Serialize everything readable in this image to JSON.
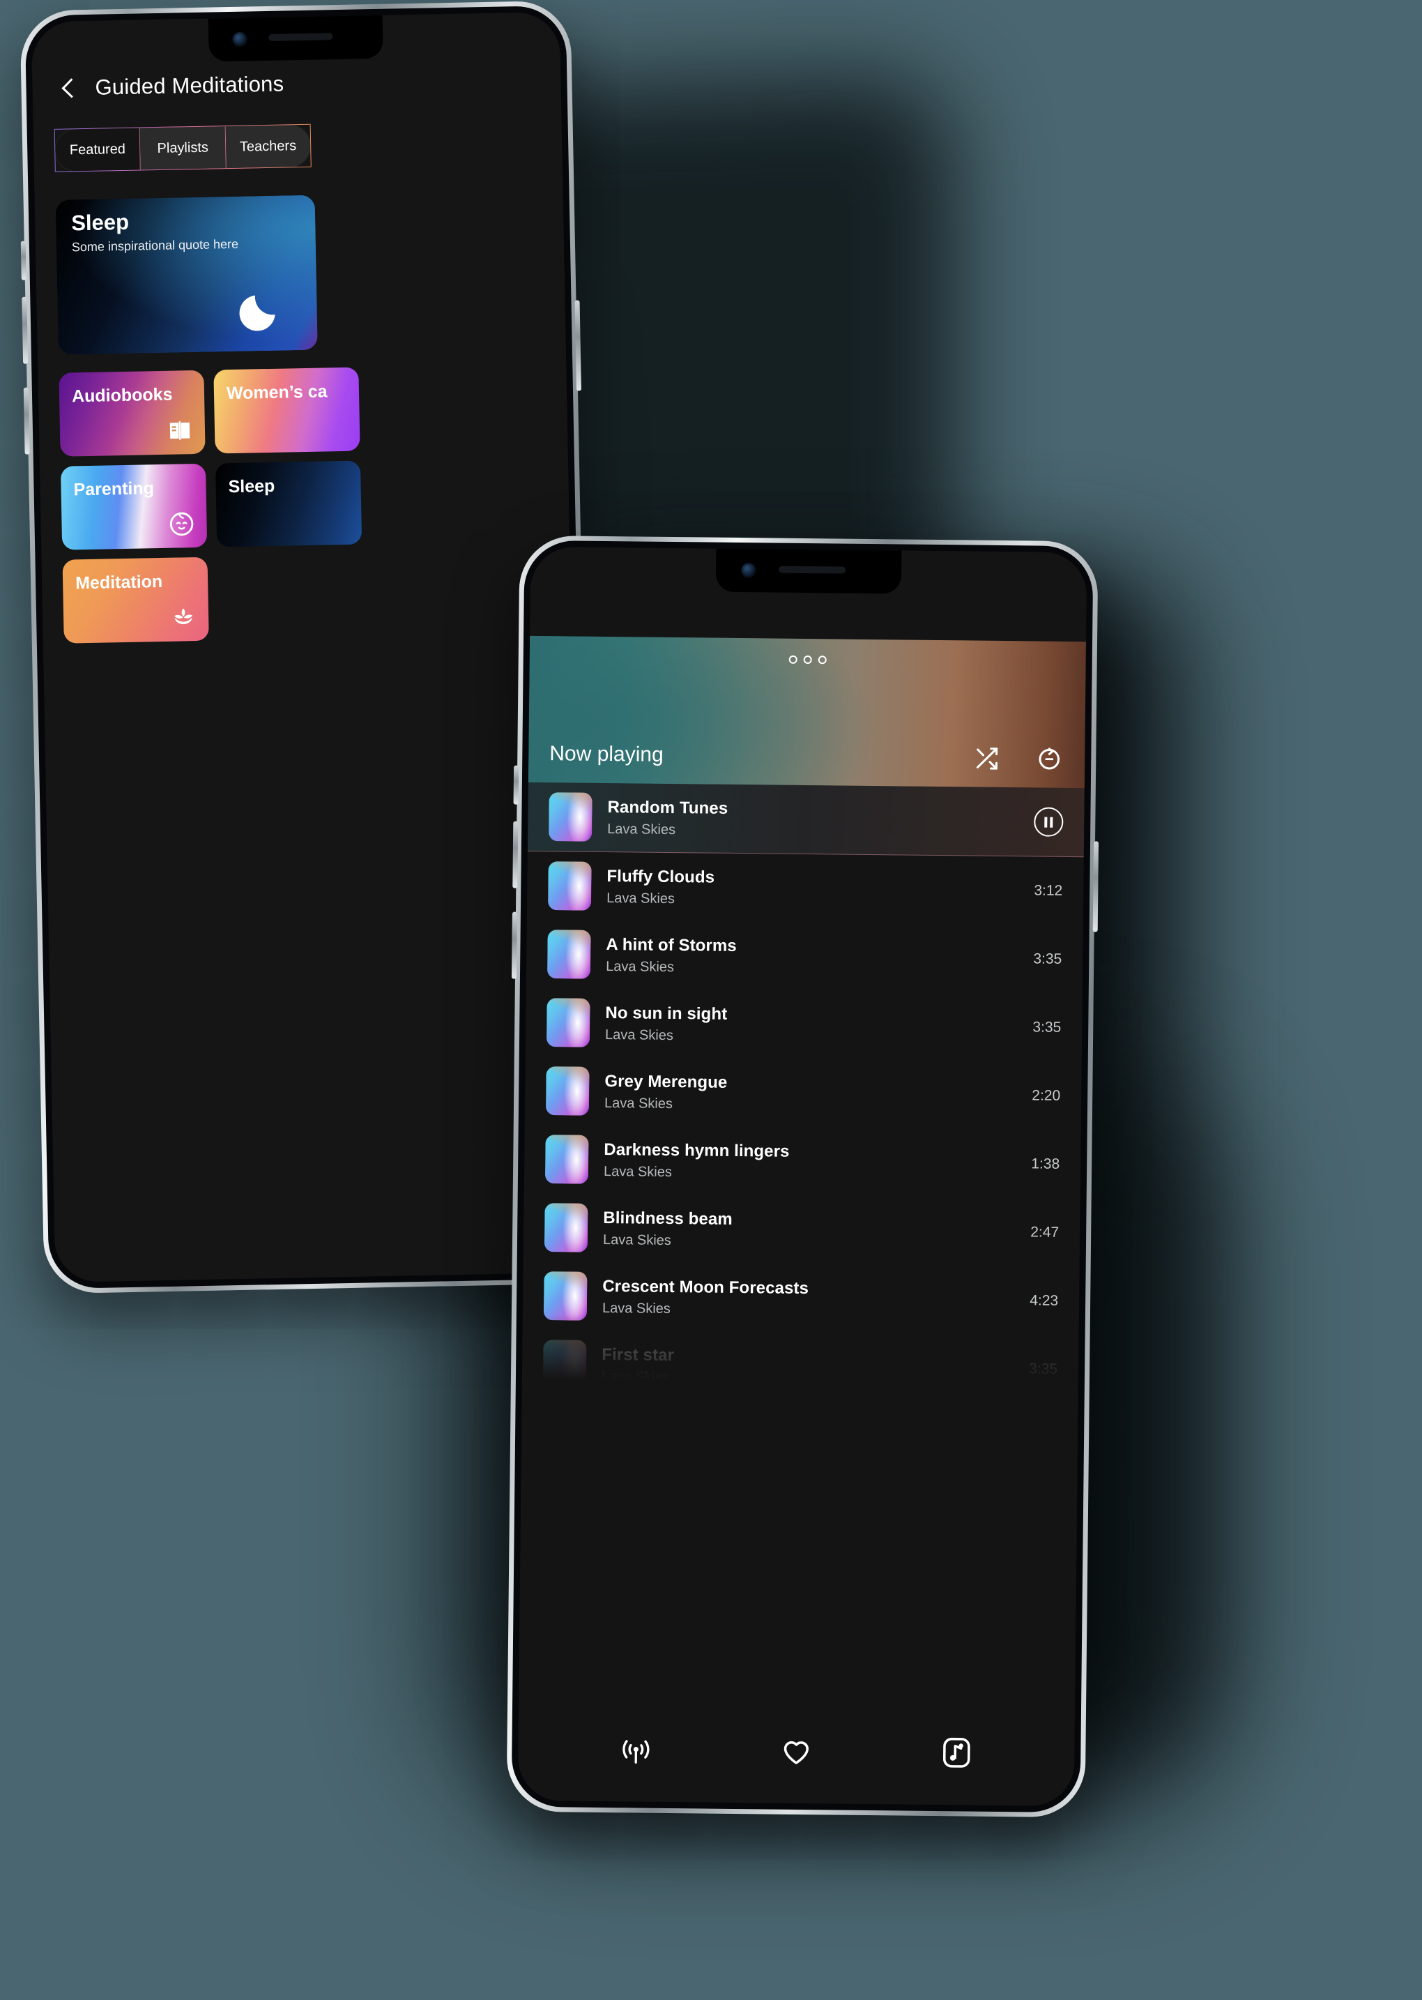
{
  "background_color": "#4a6670",
  "phone_a": {
    "header": {
      "back_icon": "chevron-left-icon",
      "title": "Guided Meditations"
    },
    "tabs": [
      {
        "label": "Featured",
        "active": true
      },
      {
        "label": "Playlists",
        "active": false
      },
      {
        "label": "Teachers",
        "active": false
      }
    ],
    "hero": {
      "title": "Sleep",
      "subtitle": "Some inspirational quote here",
      "icon": "crescent-moon-icon"
    },
    "tiles": [
      {
        "label": "Audiobooks",
        "icon": "open-book-icon",
        "style": "t-audiobooks"
      },
      {
        "label": "Women’s ca",
        "icon": "none",
        "style": "t-womens"
      },
      {
        "label": "Parenting",
        "icon": "baby-face-icon",
        "style": "t-parenting"
      },
      {
        "label": "Sleep",
        "icon": "none",
        "style": "t-sleep"
      },
      {
        "label": "Meditation",
        "icon": "lotus-flower-icon",
        "style": "t-meditation"
      }
    ]
  },
  "phone_b": {
    "header": {
      "title": "Now playing",
      "menu_icon": "three-dots-icon",
      "shuffle_icon": "shuffle-icon",
      "repeat_icon": "repeat-icon"
    },
    "tracks": [
      {
        "name": "Random Tunes",
        "artist": "Lava Skies",
        "duration": "",
        "current": true,
        "control_icon": "pause-icon"
      },
      {
        "name": "Fluffy Clouds",
        "artist": "Lava Skies",
        "duration": "3:12",
        "current": false
      },
      {
        "name": "A hint of Storms",
        "artist": "Lava Skies",
        "duration": "3:35",
        "current": false
      },
      {
        "name": "No sun in sight",
        "artist": "Lava Skies",
        "duration": "3:35",
        "current": false
      },
      {
        "name": "Grey Merengue",
        "artist": "Lava Skies",
        "duration": "2:20",
        "current": false
      },
      {
        "name": "Darkness hymn lingers",
        "artist": "Lava Skies",
        "duration": "1:38",
        "current": false
      },
      {
        "name": "Blindness beam",
        "artist": "Lava Skies",
        "duration": "2:47",
        "current": false
      },
      {
        "name": "Crescent Moon Forecasts",
        "artist": "Lava Skies",
        "duration": "4:23",
        "current": false
      },
      {
        "name": "First star",
        "artist": "Lava Skies",
        "duration": "3:35",
        "current": false,
        "faded": true
      }
    ],
    "bottom_nav": [
      {
        "icon": "broadcast-icon"
      },
      {
        "icon": "heart-icon"
      },
      {
        "icon": "music-note-square-icon"
      }
    ]
  }
}
